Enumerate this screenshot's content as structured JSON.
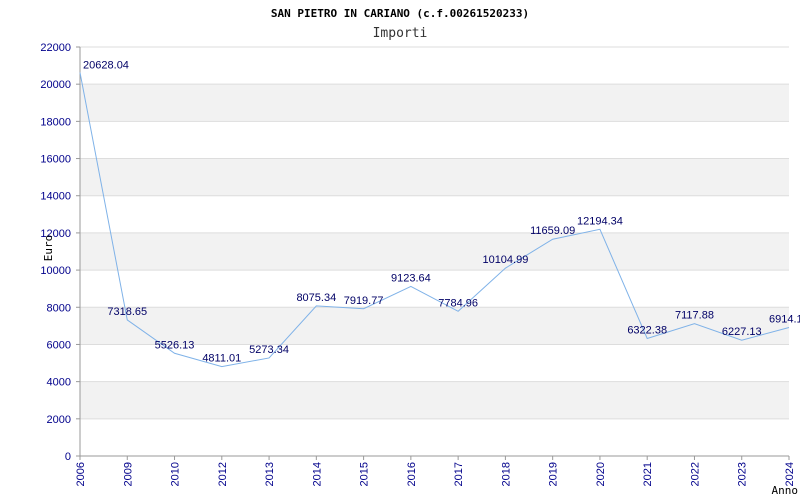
{
  "chart_data": {
    "type": "line",
    "title": "SAN PIETRO IN CARIANO (c.f.00261520233)",
    "subtitle": "Importi",
    "ylabel": "Euro",
    "xlabel": "Anno",
    "ylim": [
      0,
      22000
    ],
    "yticks": [
      0,
      2000,
      4000,
      6000,
      8000,
      10000,
      12000,
      14000,
      16000,
      18000,
      20000,
      22000
    ],
    "categories": [
      "2006",
      "2009",
      "2010",
      "2012",
      "2013",
      "2014",
      "2015",
      "2016",
      "2017",
      "2018",
      "2019",
      "2020",
      "2021",
      "2022",
      "2023",
      "2024"
    ],
    "values": [
      20628.04,
      7318.65,
      5526.13,
      4811.01,
      5273.34,
      8075.34,
      7919.77,
      9123.64,
      7784.96,
      10104.99,
      11659.09,
      12194.34,
      6322.38,
      7117.88,
      6227.13,
      6914.1
    ],
    "data_labels": [
      "20628.04",
      "7318.65",
      "5526.13",
      "4811.01",
      "5273.34",
      "8075.34",
      "7919.77",
      "9123.64",
      "7784.96",
      "10104.99",
      "11659.09",
      "12194.34",
      "6322.38",
      "7117.88",
      "6227.13",
      "6914.1"
    ],
    "grid": "horizontal alternating bands",
    "legend": "none",
    "colors": {
      "line": "#7fb2e8",
      "band": "#f2f2f2",
      "axis": "#999999",
      "tick_text": "#00008b"
    }
  }
}
